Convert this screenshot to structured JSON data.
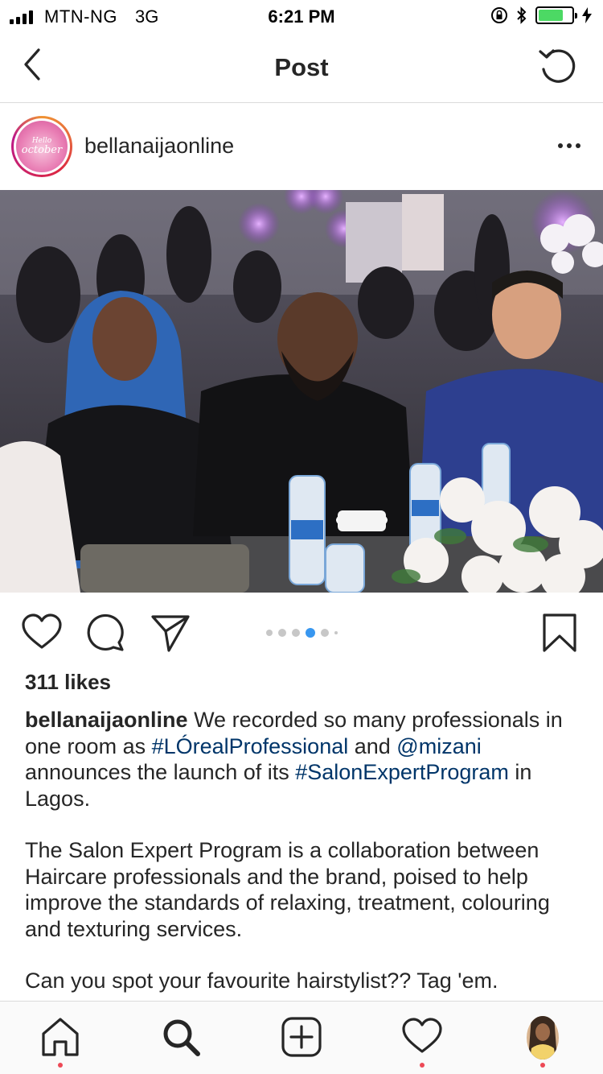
{
  "status_bar": {
    "carrier": "MTN-NG",
    "network": "3G",
    "time": "6:21 PM",
    "battery_level": 0.75,
    "icons": [
      "signal-icon",
      "orientation-lock-icon",
      "bluetooth-icon",
      "battery-icon",
      "charging-icon"
    ]
  },
  "nav": {
    "title": "Post",
    "back_icon": "chevron-left-icon",
    "refresh_icon": "refresh-icon"
  },
  "post": {
    "username": "bellanaijaonline",
    "avatar_text_line1": "Hello",
    "avatar_text_line2": "october",
    "more_icon": "more-horizontal-icon",
    "photo_icon": "photo",
    "carousel": {
      "count": 6,
      "active_index": 3
    },
    "likes": "311 likes",
    "caption": {
      "username": "bellanaijaonline",
      "p1_a": " We recorded so many professionals in one room as ",
      "hashtag1": "#LÓrealProfessional",
      "p1_b": " and ",
      "mention1": "@mizani",
      "p1_c": " announces the launch of its ",
      "hashtag2": "#SalonExpertProgram",
      "p1_d": " in Lagos.",
      "p2": "The Salon Expert Program is a collaboration between Haircare professionals and the brand, poised to help improve the standards of relaxing, treatment, colouring and texturing services.",
      "p3": "Can you spot your favourite hairstylist?? Tag 'em."
    }
  },
  "tabbar": {
    "items": [
      {
        "name": "home",
        "icon": "home-icon",
        "notification": true
      },
      {
        "name": "search",
        "icon": "search-icon",
        "notification": false
      },
      {
        "name": "add",
        "icon": "add-post-icon",
        "notification": false
      },
      {
        "name": "activity",
        "icon": "heart-icon",
        "notification": true
      },
      {
        "name": "profile",
        "icon": "profile-avatar",
        "notification": true
      }
    ]
  },
  "colors": {
    "link": "#003569",
    "notification": "#ed4956",
    "carousel_active": "#3897f0",
    "battery": "#4cd964"
  }
}
